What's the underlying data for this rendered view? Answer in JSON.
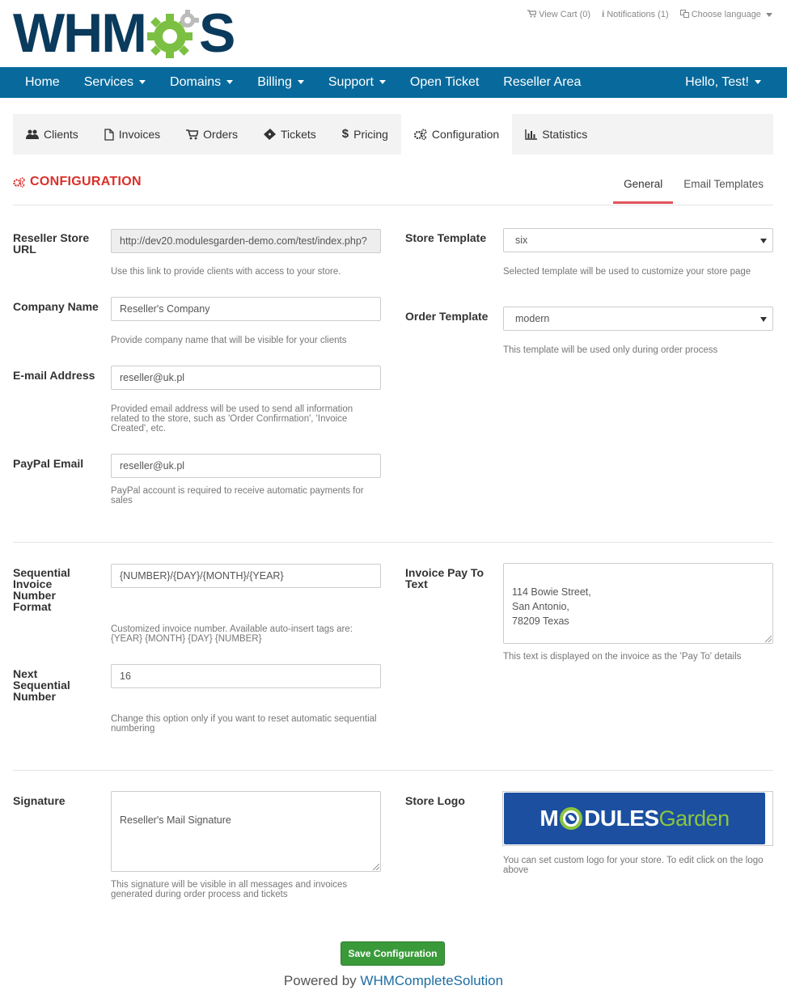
{
  "brand": {
    "logo_text_left": "WHM",
    "logo_text_right": "S"
  },
  "toplinks": {
    "cart": "View Cart (0)",
    "notifications": "Notifications (1)",
    "language": "Choose language"
  },
  "nav": {
    "items": [
      {
        "label": "Home",
        "dropdown": false
      },
      {
        "label": "Services",
        "dropdown": true
      },
      {
        "label": "Domains",
        "dropdown": true
      },
      {
        "label": "Billing",
        "dropdown": true
      },
      {
        "label": "Support",
        "dropdown": true
      },
      {
        "label": "Open Ticket",
        "dropdown": false
      },
      {
        "label": "Reseller Area",
        "dropdown": false
      }
    ],
    "user": "Hello, Test!"
  },
  "tabs": [
    {
      "label": "Clients",
      "icon": "users-icon"
    },
    {
      "label": "Invoices",
      "icon": "file-icon"
    },
    {
      "label": "Orders",
      "icon": "cart-icon"
    },
    {
      "label": "Tickets",
      "icon": "ticket-icon"
    },
    {
      "label": "Pricing",
      "icon": "dollar-icon"
    },
    {
      "label": "Configuration",
      "icon": "gears-icon",
      "active": true
    },
    {
      "label": "Statistics",
      "icon": "bar-chart-icon"
    }
  ],
  "section": {
    "title": "CONFIGURATION"
  },
  "subtabs": {
    "general": "General",
    "email_templates": "Email Templates"
  },
  "form": {
    "store_url": {
      "label": "Reseller Store URL",
      "value": "http://dev20.modulesgarden-demo.com/test/index.php?",
      "help": "Use this link to provide clients with access to your store."
    },
    "company": {
      "label": "Company Name",
      "value": "Reseller's Company",
      "help": "Provide company name that will be visible for your clients"
    },
    "email": {
      "label": "E-mail Address",
      "value": "reseller@uk.pl",
      "help": "Provided email address will be used to send all information related to the store, such as 'Order Confirmation', 'Invoice Created', etc."
    },
    "paypal": {
      "label": "PayPal Email",
      "value": "reseller@uk.pl",
      "help": "PayPal account is required to receive automatic payments for sales"
    },
    "store_template": {
      "label": "Store Template",
      "value": "six",
      "help": "Selected template will be used to customize your store page"
    },
    "order_template": {
      "label": "Order Template",
      "value": "modern",
      "help": "This template will be used only during order process"
    },
    "invoice_format": {
      "label": "Sequential Invoice Number Format",
      "value": "{NUMBER}/{DAY}/{MONTH}/{YEAR}",
      "help": "Customized invoice number. Available auto-insert tags are: {YEAR} {MONTH} {DAY} {NUMBER}"
    },
    "next_number": {
      "label": "Next Sequential Number",
      "value": "16",
      "help": "Change this option only if you want to reset automatic sequential numbering"
    },
    "pay_to": {
      "label": "Invoice Pay To Text",
      "value": "114 Bowie Street,\nSan Antonio,\n78209 Texas",
      "help": "This text is displayed on the invoice as the 'Pay To' details"
    },
    "signature": {
      "label": "Signature",
      "value": "Reseller's Mail Signature",
      "help": "This signature will be visible in all messages and invoices generated during order process and tickets"
    },
    "store_logo": {
      "label": "Store Logo",
      "logo_text_a": "M",
      "logo_text_b": "DULES",
      "logo_text_c": "Garden",
      "help": "You can set custom logo for your store. To edit click on the logo above"
    }
  },
  "save_button": "Save Configuration",
  "footer": {
    "prefix": "Powered by ",
    "link": "WHMCompleteSolution"
  },
  "colors": {
    "nav_bg": "#086a9c",
    "title_red": "#d9302a",
    "save_green": "#3a9a3a",
    "logo_navy": "#0a3a5c",
    "logo_green": "#7bc043"
  }
}
